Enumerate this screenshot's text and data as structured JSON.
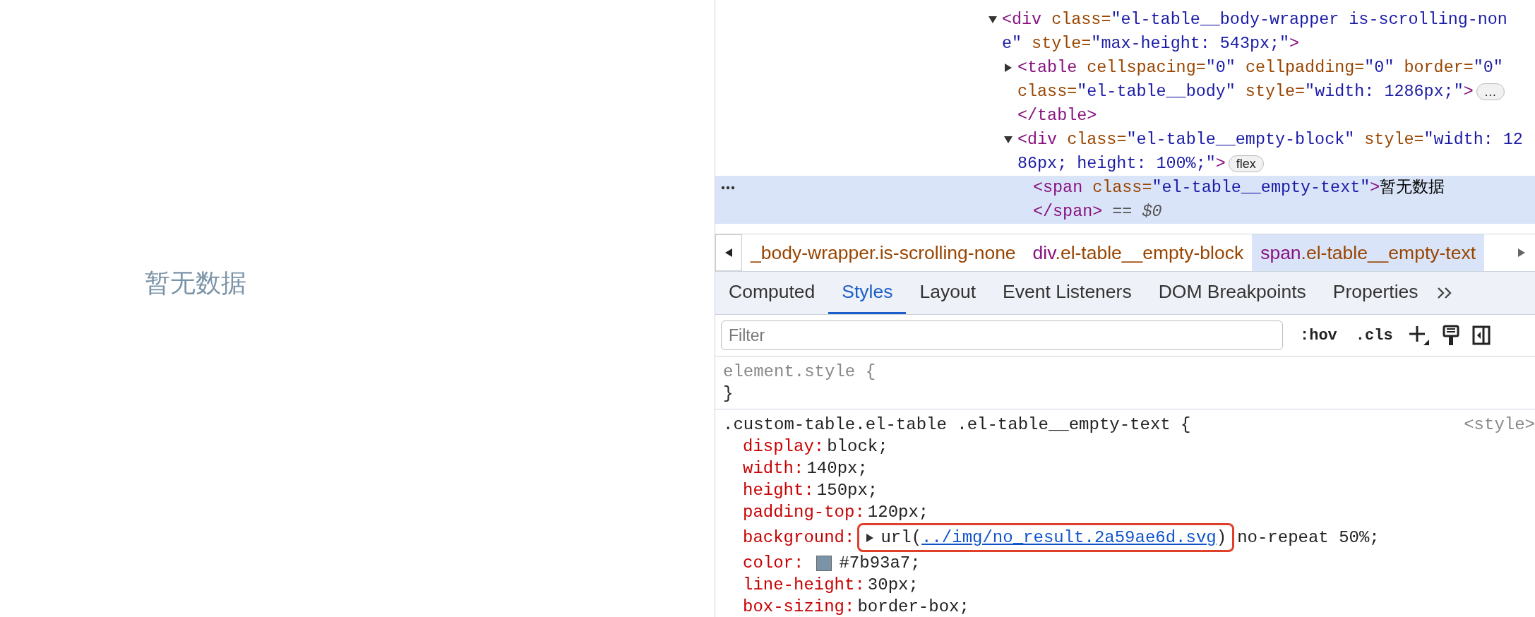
{
  "page": {
    "empty_text": "暂无数据"
  },
  "dom_tree": [
    {
      "expanded": true,
      "lines": [
        [
          {
            "kind": "tag",
            "text": "<div"
          },
          {
            "kind": "attr",
            "text": " class="
          },
          {
            "kind": "value",
            "text": "\"el-table__body-wrapper is-scrolling-non"
          }
        ],
        [
          {
            "kind": "value",
            "text": "e\""
          },
          {
            "kind": "attr",
            "text": " style="
          },
          {
            "kind": "value",
            "text": "\"max-height: 543px;\""
          },
          {
            "kind": "tag",
            "text": ">"
          }
        ]
      ],
      "children": [
        {
          "expanded": false,
          "badge": "…",
          "lines": [
            [
              {
                "kind": "tag",
                "text": "<table"
              },
              {
                "kind": "attr",
                "text": " cellspacing="
              },
              {
                "kind": "value",
                "text": "\"0\""
              },
              {
                "kind": "attr",
                "text": " cellpadding="
              },
              {
                "kind": "value",
                "text": "\"0\""
              },
              {
                "kind": "attr",
                "text": " border="
              },
              {
                "kind": "value",
                "text": "\"0\""
              }
            ],
            [
              {
                "kind": "attr",
                "text": "class="
              },
              {
                "kind": "value",
                "text": "\"el-table__body\""
              },
              {
                "kind": "attr",
                "text": " style="
              },
              {
                "kind": "value",
                "text": "\"width: 1286px;\""
              },
              {
                "kind": "tag",
                "text": ">"
              }
            ]
          ],
          "close_lines": [
            [
              {
                "kind": "tag",
                "text": "</table>"
              }
            ]
          ]
        },
        {
          "expanded": true,
          "badge": "flex",
          "lines": [
            [
              {
                "kind": "tag",
                "text": "<div"
              },
              {
                "kind": "attr",
                "text": " class="
              },
              {
                "kind": "value",
                "text": "\"el-table__empty-block\""
              },
              {
                "kind": "attr",
                "text": " style="
              },
              {
                "kind": "value",
                "text": "\"width: 12"
              }
            ],
            [
              {
                "kind": "value",
                "text": "86px; height: 100%;\""
              },
              {
                "kind": "tag",
                "text": ">"
              }
            ]
          ],
          "children": [
            {
              "selected": true,
              "lines": [
                [
                  {
                    "kind": "tag",
                    "text": "<span"
                  },
                  {
                    "kind": "attr",
                    "text": " class="
                  },
                  {
                    "kind": "value",
                    "text": "\"el-table__empty-text\""
                  },
                  {
                    "kind": "tag",
                    "text": ">"
                  },
                  {
                    "kind": "text",
                    "text": "暂无数据"
                  }
                ]
              ],
              "close_lines": [
                [
                  {
                    "kind": "tag",
                    "text": "</span>"
                  },
                  {
                    "kind": "eq",
                    "text": " == "
                  },
                  {
                    "kind": "ref",
                    "text": "$0"
                  }
                ]
              ]
            }
          ]
        }
      ]
    }
  ],
  "breadcrumbs": [
    {
      "cls": "_body-wrapper.is-scrolling-none",
      "selected": false
    },
    {
      "tag": "div",
      "cls": ".el-table__empty-block",
      "selected": false
    },
    {
      "tag": "span",
      "cls": ".el-table__empty-text",
      "selected": true
    }
  ],
  "tabs": [
    {
      "label": "Computed",
      "selected": false
    },
    {
      "label": "Styles",
      "selected": true
    },
    {
      "label": "Layout",
      "selected": false
    },
    {
      "label": "Event Listeners",
      "selected": false
    },
    {
      "label": "DOM Breakpoints",
      "selected": false
    },
    {
      "label": "Properties",
      "selected": false
    }
  ],
  "filter": {
    "placeholder": "Filter"
  },
  "toolbar": [
    ":hov",
    ".cls"
  ],
  "rules": [
    {
      "selector": "element.style",
      "inline": true,
      "open": "{",
      "close": "}"
    },
    {
      "selector": ".custom-table.el-table .el-table__empty-text",
      "inline": false,
      "open": "{",
      "source": "<style>",
      "properties": [
        {
          "kind": "plain",
          "name": "display:",
          "value": "block;"
        },
        {
          "kind": "plain",
          "name": "width:",
          "value": "140px;"
        },
        {
          "kind": "plain",
          "name": "height:",
          "value": "150px;"
        },
        {
          "kind": "plain",
          "name": "padding-top:",
          "value": "120px;"
        },
        {
          "kind": "url",
          "name": "background:",
          "prefix": "url(",
          "link": "../img/no_result.2a59ae6d.svg",
          "suffix": ")",
          "rest": "no-repeat 50%;",
          "highlighted": true
        },
        {
          "kind": "color",
          "name": "color:",
          "color": "#7b93a7",
          "value": "#7b93a7;"
        },
        {
          "kind": "plain",
          "name": "line-height:",
          "value": "30px;"
        },
        {
          "kind": "plain",
          "name": "box-sizing:",
          "value": "border-box;"
        }
      ]
    }
  ]
}
